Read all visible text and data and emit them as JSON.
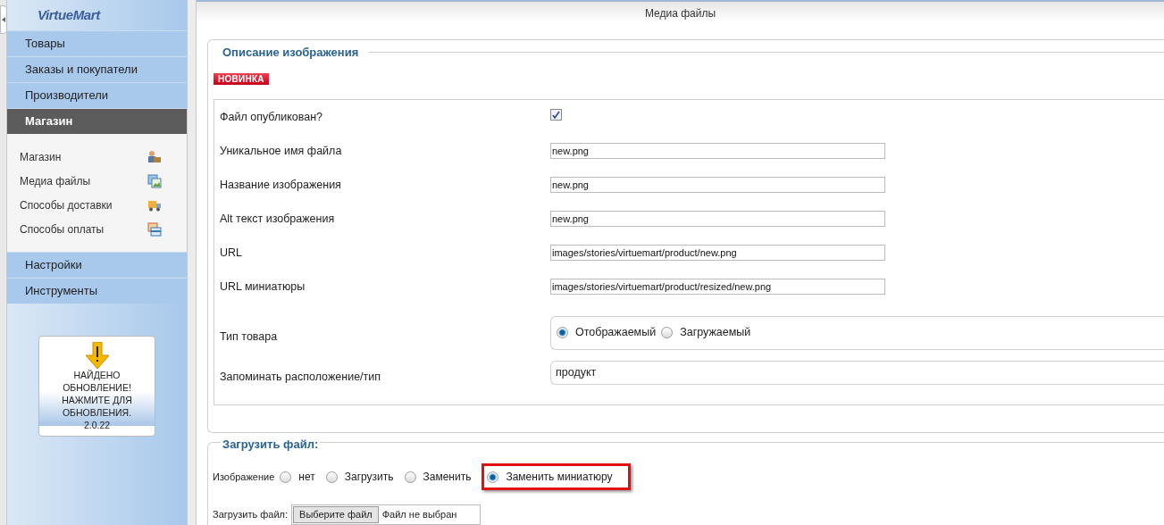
{
  "sidebar": {
    "logo": "VirtueMart",
    "menu": [
      {
        "label": "Товары",
        "selected": false
      },
      {
        "label": "Заказы и покупатели",
        "selected": false
      },
      {
        "label": "Производители",
        "selected": false
      },
      {
        "label": "Магазин",
        "selected": true,
        "children": [
          {
            "label": "Магазин",
            "kind": "person"
          },
          {
            "label": "Медиа файлы",
            "kind": "images"
          },
          {
            "label": "Способы доставки",
            "kind": "truck"
          },
          {
            "label": "Способы оплаты",
            "kind": "card"
          }
        ]
      },
      {
        "label": "Настройки",
        "selected": false
      },
      {
        "label": "Инструменты",
        "selected": false
      }
    ],
    "update_notice": {
      "text": "НАЙДЕНО ОБНОВЛЕНИЕ! НАЖМИТЕ ДЛЯ ОБНОВЛЕНИЯ.",
      "version": "2.0.22"
    }
  },
  "page_title": "Медиа файлы",
  "image_description": {
    "legend": "Описание изображения",
    "badge": "НОВИНКА",
    "rows": [
      {
        "kind": "checkbox",
        "label": "Файл опубликован?",
        "checked": true
      },
      {
        "kind": "text",
        "label": "Уникальное имя файла",
        "value": "new.png"
      },
      {
        "kind": "text",
        "label": "Название изображения",
        "value": "new.png"
      },
      {
        "kind": "text",
        "label": "Alt текст изображения",
        "value": "new.png"
      },
      {
        "kind": "text",
        "label": "URL",
        "value": "images/stories/virtuemart/product/new.png"
      },
      {
        "kind": "text",
        "label": "URL миниатюры",
        "value": "images/stories/virtuemart/product/resized/new.png"
      },
      {
        "kind": "radio",
        "label": "Тип товара",
        "options": [
          {
            "label": "Отображаемый",
            "selected": true
          },
          {
            "label": "Загружаемый",
            "selected": false
          }
        ]
      },
      {
        "kind": "display",
        "label": "Запоминать расположение/тип",
        "value": "продукт"
      }
    ]
  },
  "upload": {
    "legend": "Загрузить файл:",
    "label": "Изображение",
    "options": [
      {
        "label": "нет",
        "selected": false,
        "highlighted": false
      },
      {
        "label": "Загрузить",
        "selected": false,
        "highlighted": false
      },
      {
        "label": "Заменить",
        "selected": false,
        "highlighted": false
      },
      {
        "label": "Заменить миниатюру",
        "selected": true,
        "highlighted": true
      }
    ],
    "file_label": "Загрузить файл:",
    "file_button": "Выберите файл",
    "file_status": "Файл не выбран"
  }
}
